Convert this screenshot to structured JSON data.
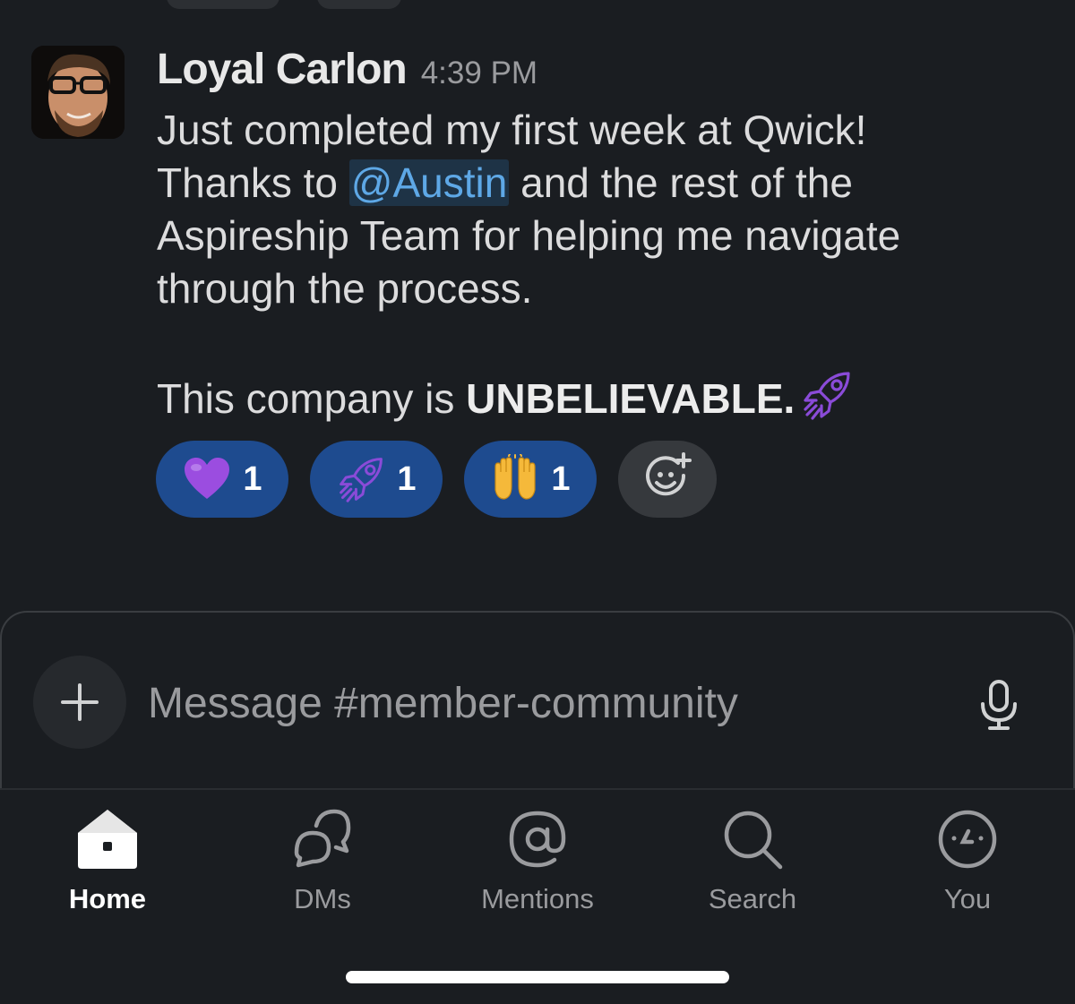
{
  "message": {
    "author": "Loyal Carlon",
    "timestamp": "4:39 PM",
    "line1": "Just completed my first week at Qwick!",
    "line2_pre": "Thanks to ",
    "mention": "@Austin",
    "line2_post": " and the rest of the",
    "line3": "Aspireship Team for helping me navigate",
    "line4": "through the process.",
    "line5_pre": "This company is ",
    "line5_bold": "UNBELIEVABLE.",
    "inline_emoji": "rocket-icon"
  },
  "reactions": [
    {
      "emoji": "purple-heart-icon",
      "count": "1"
    },
    {
      "emoji": "rocket-icon",
      "count": "1"
    },
    {
      "emoji": "raising-hands-icon",
      "count": "1"
    }
  ],
  "composer": {
    "placeholder": "Message #member-community"
  },
  "tabs": [
    {
      "label": "Home",
      "icon": "home-icon",
      "active": true
    },
    {
      "label": "DMs",
      "icon": "dms-icon"
    },
    {
      "label": "Mentions",
      "icon": "mentions-icon"
    },
    {
      "label": "Search",
      "icon": "search-icon"
    },
    {
      "label": "You",
      "icon": "you-icon"
    }
  ],
  "colors": {
    "background": "#1a1d21",
    "reaction_bg": "#1e4b8f",
    "mention": "#5ea8e6",
    "emoji_purple": "#8a4bd8"
  }
}
